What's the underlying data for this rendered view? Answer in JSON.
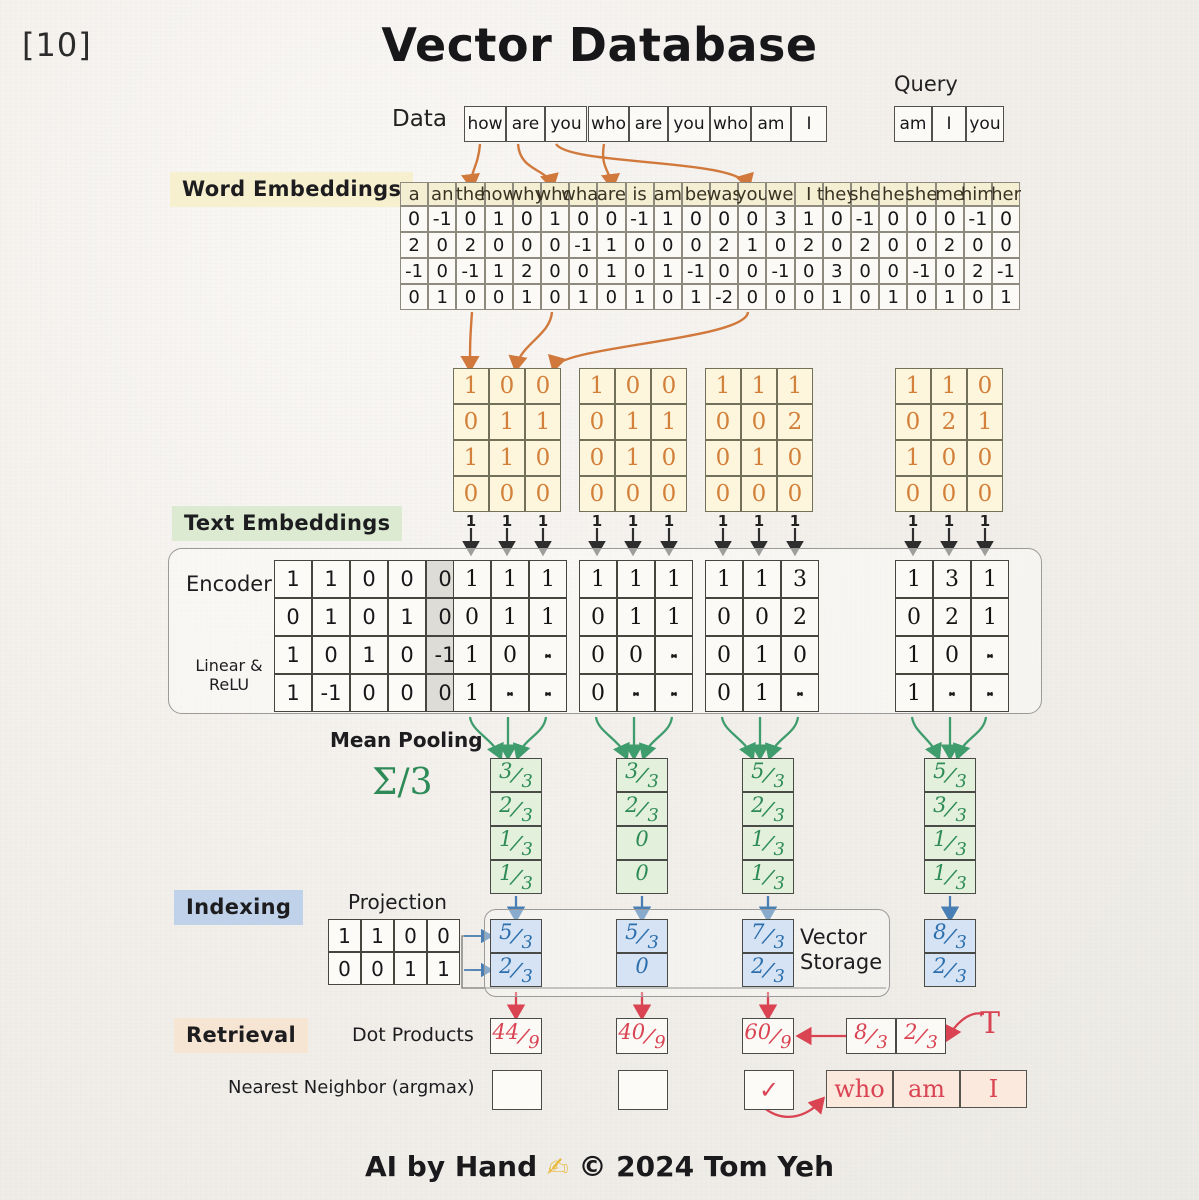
{
  "page_number": "[10]",
  "title": "Vector Database",
  "footer": {
    "text_left": "AI by Hand",
    "pen_icon": "pencil-icon",
    "text_right": "© 2024 Tom Yeh"
  },
  "labels": {
    "data": "Data",
    "query": "Query",
    "word_embeddings": "Word Embeddings",
    "text_embeddings": "Text Embeddings",
    "indexing": "Indexing",
    "retrieval": "Retrieval",
    "encoder": "Encoder",
    "linear_relu": "Linear &\nReLU",
    "mean_pooling": "Mean Pooling",
    "sigma": "Σ/3",
    "projection": "Projection",
    "vector_storage": "Vector\nStorage",
    "dot_products": "Dot Products",
    "nearest_neighbor": "Nearest Neighbor (argmax)",
    "transpose": "T"
  },
  "colors": {
    "word_tag_bg": "#f7f0ce",
    "text_tag_bg": "#dcead2",
    "index_tag_bg": "#bfd2ea",
    "retrieval_tag_bg": "#f7e5d4",
    "orange": "#d2803a",
    "green": "#2e8b57",
    "blue": "#2d6fad",
    "red": "#d94352",
    "paper": "#f2efea"
  },
  "data_sentences": [
    {
      "tokens": [
        "how",
        "are",
        "you"
      ]
    },
    {
      "tokens": [
        "who",
        "are",
        "you"
      ]
    },
    {
      "tokens": [
        "who",
        "am",
        "I"
      ]
    }
  ],
  "query_tokens": [
    "am",
    "I",
    "you"
  ],
  "word_embedding_table": {
    "vocabulary": [
      "a",
      "an",
      "the",
      "how",
      "why",
      "who",
      "what",
      "are",
      "is",
      "am",
      "be",
      "was",
      "you",
      "we",
      "I",
      "they",
      "she",
      "he",
      "she",
      "me",
      "him",
      "her"
    ],
    "rows": [
      [
        "0",
        "-1",
        "0",
        "1",
        "0",
        "1",
        "0",
        "0",
        "-1",
        "1",
        "0",
        "0",
        "0",
        "3",
        "1",
        "0",
        "-1",
        "0",
        "0",
        "0",
        "-1",
        "0"
      ],
      [
        "2",
        "0",
        "2",
        "0",
        "0",
        "0",
        "-1",
        "1",
        "0",
        "0",
        "0",
        "2",
        "1",
        "0",
        "2",
        "0",
        "2",
        "0",
        "0",
        "2",
        "0",
        "0"
      ],
      [
        "-1",
        "0",
        "-1",
        "1",
        "2",
        "0",
        "0",
        "1",
        "0",
        "1",
        "-1",
        "0",
        "0",
        "-1",
        "0",
        "3",
        "0",
        "0",
        "-1",
        "0",
        "2",
        "-1"
      ],
      [
        "0",
        "1",
        "0",
        "0",
        "1",
        "0",
        "1",
        "0",
        "1",
        "0",
        "1",
        "-2",
        "0",
        "0",
        "0",
        "1",
        "0",
        "1",
        "0",
        "1",
        "0",
        "1"
      ]
    ]
  },
  "token_embedding_blocks": [
    {
      "name": "how are you",
      "rows": [
        [
          "1",
          "0",
          "0"
        ],
        [
          "0",
          "1",
          "1"
        ],
        [
          "1",
          "1",
          "0"
        ],
        [
          "0",
          "0",
          "0"
        ]
      ],
      "ones": [
        "1",
        "1",
        "1"
      ]
    },
    {
      "name": "who are you",
      "rows": [
        [
          "1",
          "0",
          "0"
        ],
        [
          "0",
          "1",
          "1"
        ],
        [
          "0",
          "1",
          "0"
        ],
        [
          "0",
          "0",
          "0"
        ]
      ],
      "ones": [
        "1",
        "1",
        "1"
      ]
    },
    {
      "name": "who am I",
      "rows": [
        [
          "1",
          "1",
          "1"
        ],
        [
          "0",
          "0",
          "2"
        ],
        [
          "0",
          "1",
          "0"
        ],
        [
          "0",
          "0",
          "0"
        ]
      ],
      "ones": [
        "1",
        "1",
        "1"
      ]
    },
    {
      "name": "query am I you",
      "rows": [
        [
          "1",
          "1",
          "0"
        ],
        [
          "0",
          "2",
          "1"
        ],
        [
          "1",
          "0",
          "0"
        ],
        [
          "0",
          "0",
          "0"
        ]
      ],
      "ones": [
        "1",
        "1",
        "1"
      ]
    }
  ],
  "encoder_matrix": {
    "rows": [
      [
        "1",
        "1",
        "0",
        "0",
        "0"
      ],
      [
        "0",
        "1",
        "0",
        "1",
        "0"
      ],
      [
        "1",
        "0",
        "1",
        "0",
        "-1"
      ],
      [
        "1",
        "-1",
        "0",
        "0",
        "0"
      ]
    ],
    "shaded_column_index": 4
  },
  "encoder_output_blocks": [
    {
      "name": "how are you",
      "rows": [
        [
          "1",
          "1",
          "1"
        ],
        [
          "0",
          "1",
          "1"
        ],
        [
          "1",
          "0",
          "X"
        ],
        [
          "1",
          "X",
          "X"
        ]
      ]
    },
    {
      "name": "who are you",
      "rows": [
        [
          "1",
          "1",
          "1"
        ],
        [
          "0",
          "1",
          "1"
        ],
        [
          "0",
          "0",
          "X"
        ],
        [
          "0",
          "X",
          "X"
        ]
      ]
    },
    {
      "name": "who am I",
      "rows": [
        [
          "1",
          "1",
          "3"
        ],
        [
          "0",
          "0",
          "2"
        ],
        [
          "0",
          "1",
          "0"
        ],
        [
          "0",
          "1",
          "X"
        ]
      ]
    },
    {
      "name": "query",
      "rows": [
        [
          "1",
          "3",
          "1"
        ],
        [
          "0",
          "2",
          "1"
        ],
        [
          "1",
          "0",
          "X"
        ],
        [
          "1",
          "X",
          "X"
        ]
      ]
    }
  ],
  "mean_pooling_blocks": [
    {
      "name": "how are you",
      "values": [
        {
          "n": "3",
          "d": "3"
        },
        {
          "n": "2",
          "d": "3"
        },
        {
          "n": "1",
          "d": "3"
        },
        {
          "n": "1",
          "d": "3"
        }
      ]
    },
    {
      "name": "who are you",
      "values": [
        {
          "n": "3",
          "d": "3"
        },
        {
          "n": "2",
          "d": "3"
        },
        {
          "n": "0",
          "d": ""
        },
        {
          "n": "0",
          "d": ""
        }
      ]
    },
    {
      "name": "who am I",
      "values": [
        {
          "n": "5",
          "d": "3"
        },
        {
          "n": "2",
          "d": "3"
        },
        {
          "n": "1",
          "d": "3"
        },
        {
          "n": "1",
          "d": "3"
        }
      ]
    },
    {
      "name": "query",
      "values": [
        {
          "n": "5",
          "d": "3"
        },
        {
          "n": "3",
          "d": "3"
        },
        {
          "n": "1",
          "d": "3"
        },
        {
          "n": "1",
          "d": "3"
        }
      ]
    }
  ],
  "projection_matrix": {
    "rows": [
      [
        "1",
        "1",
        "0",
        "0"
      ],
      [
        "0",
        "0",
        "1",
        "1"
      ]
    ]
  },
  "vector_storage_blocks": [
    {
      "name": "how are you",
      "values": [
        {
          "n": "5",
          "d": "3"
        },
        {
          "n": "2",
          "d": "3"
        }
      ]
    },
    {
      "name": "who are you",
      "values": [
        {
          "n": "5",
          "d": "3"
        },
        {
          "n": "0",
          "d": ""
        }
      ]
    },
    {
      "name": "who am I",
      "values": [
        {
          "n": "7",
          "d": "3"
        },
        {
          "n": "2",
          "d": "3"
        }
      ]
    },
    {
      "name": "query",
      "values": [
        {
          "n": "8",
          "d": "3"
        },
        {
          "n": "2",
          "d": "3"
        }
      ]
    }
  ],
  "dot_products": [
    {
      "n": "44",
      "d": "9"
    },
    {
      "n": "40",
      "d": "9"
    },
    {
      "n": "60",
      "d": "9"
    }
  ],
  "query_vector_transposed": [
    {
      "n": "8",
      "d": "3"
    },
    {
      "n": "2",
      "d": "3"
    }
  ],
  "nearest_neighbor": {
    "boxes": [
      "",
      "",
      "✓"
    ],
    "result_tokens": [
      "who",
      "am",
      "I"
    ]
  }
}
